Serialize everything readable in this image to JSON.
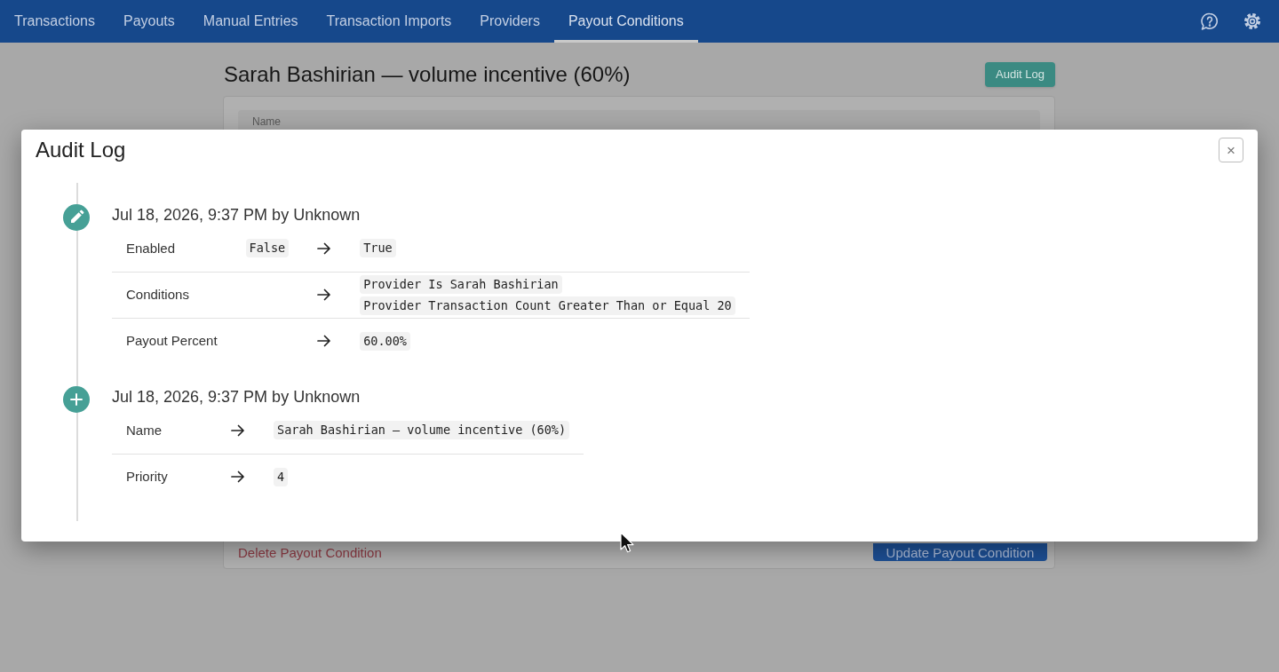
{
  "nav": {
    "tabs": [
      {
        "label": "Transactions",
        "selected": false
      },
      {
        "label": "Payouts",
        "selected": false
      },
      {
        "label": "Manual Entries",
        "selected": false
      },
      {
        "label": "Transaction Imports",
        "selected": false
      },
      {
        "label": "Providers",
        "selected": false
      },
      {
        "label": "Payout Conditions",
        "selected": true
      }
    ]
  },
  "page": {
    "title": "Sarah Bashirian — volume incentive (60%)",
    "audit_log_button": "Audit Log",
    "name_label": "Name",
    "delete_link": "Delete Payout Condition",
    "update_button": "Update Payout Condition"
  },
  "audit_log": {
    "title": "Audit Log",
    "close_label": "×",
    "entries": [
      {
        "kind": "update",
        "heading": "Jul 18, 2026, 9:37 PM by Unknown",
        "changes": [
          {
            "field": "Enabled",
            "old": [
              "False"
            ],
            "new": [
              "True"
            ]
          },
          {
            "field": "Conditions",
            "new": [
              "Provider Is Sarah Bashirian",
              "Provider Transaction Count Greater Than or Equal 20"
            ]
          },
          {
            "field": "Payout Percent",
            "new": [
              "60.00%"
            ]
          }
        ]
      },
      {
        "kind": "create",
        "heading": "Jul 18, 2026, 9:37 PM by Unknown",
        "changes": [
          {
            "field": "Name",
            "new": [
              "Sarah Bashirian — volume incentive (60%)"
            ]
          },
          {
            "field": "Priority",
            "new": [
              "4"
            ]
          }
        ]
      }
    ]
  }
}
